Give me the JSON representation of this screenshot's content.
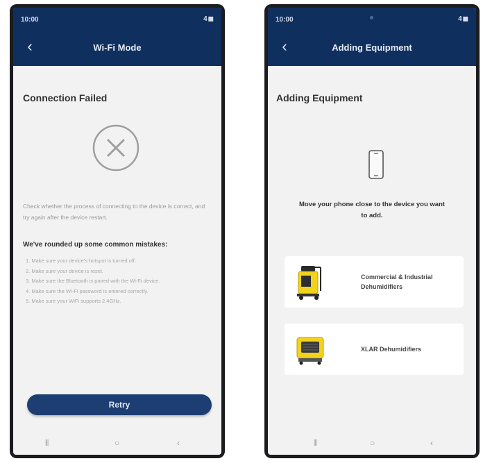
{
  "left_screen": {
    "status": {
      "time": "10:00",
      "signal": "4◼"
    },
    "appbar": {
      "back_glyph": "‹",
      "title": "Wi-Fi Mode"
    },
    "heading": "Connection Failed",
    "message": "Check whether the process of connecting to the device is correct, and try again after the device restart.",
    "mistakes_title": "We've rounded up some common mistakes:",
    "mistakes": [
      "1. Make sure your device's hotspot is turned off.",
      "2. Make sure your device is reset.",
      "3. Make sure the Bluetooth is paired with the Wi-Fi device.",
      "4. Make sure the Wi-Fi password is entered correctly.",
      "5. Make sure your WiFi supports 2.4GHz."
    ],
    "retry_label": "Retry",
    "nav": {
      "recents": "⦀",
      "home": "○",
      "back": "‹"
    }
  },
  "right_screen": {
    "status": {
      "time": "10:00",
      "signal": "4◼"
    },
    "appbar": {
      "back_glyph": "‹",
      "title": "Adding Equipment"
    },
    "heading": "Adding Equipment",
    "move_text": "Move your phone close to the device you want to add.",
    "cards": [
      {
        "label": "Commercial & Industrial Dehumidifiers"
      },
      {
        "label": "XLAR Dehumidifiers"
      }
    ],
    "nav": {
      "recents": "⦀",
      "home": "○",
      "back": "‹"
    }
  },
  "colors": {
    "appbar": "#0f2f5f",
    "retry": "#1c3e72",
    "screen_bg": "#f2f2f2",
    "product_yellow": "#f2d21b"
  }
}
